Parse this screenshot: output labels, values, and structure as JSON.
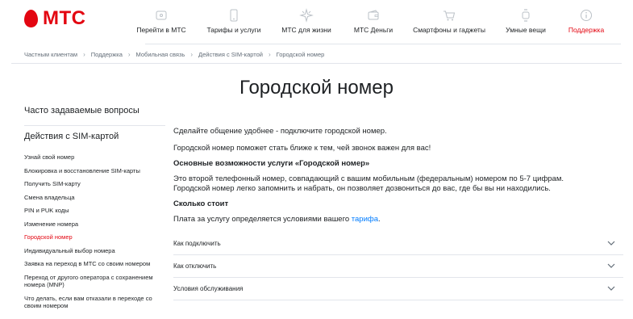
{
  "brand": {
    "name": "МТС",
    "color": "#e30611"
  },
  "nav": {
    "items": [
      {
        "icon": "mobile-icon",
        "label": "Перейти в МТС"
      },
      {
        "icon": "phone-icon",
        "label": "Тарифы и услуги"
      },
      {
        "icon": "sparkle-icon",
        "label": "МТС для жизни"
      },
      {
        "icon": "wallet-icon",
        "label": "МТС Деньги"
      },
      {
        "icon": "cart-icon",
        "label": "Смартфоны и гаджеты"
      },
      {
        "icon": "watch-icon",
        "label": "Умные вещи"
      },
      {
        "icon": "info-icon",
        "label": "Поддержка",
        "active": true
      }
    ]
  },
  "breadcrumb": [
    "Частным клиентам",
    "Поддержка",
    "Мобильная связь",
    "Действия с SIM-картой",
    "Городской номер"
  ],
  "page": {
    "title": "Городской номер"
  },
  "sidebar": {
    "faq": "Часто задаваемые вопросы",
    "heading": "Действия с SIM-картой",
    "items": [
      {
        "label": "Узнай свой номер"
      },
      {
        "label": "Блокировка и восстановление SIM-карты"
      },
      {
        "label": "Получить SIM-карту"
      },
      {
        "label": "Смена владельца"
      },
      {
        "label": "PIN и PUK коды"
      },
      {
        "label": "Изменение номера"
      },
      {
        "label": "Городской номер",
        "active": true
      },
      {
        "label": "Индивидуальный выбор номера"
      },
      {
        "label": "Заявка на переход в МТС со своим номером"
      },
      {
        "label": "Переход от другого оператора с сохранением номера (MNP)"
      },
      {
        "label": "Что делать, если вам отказали в переходе со своим номером"
      }
    ]
  },
  "content": {
    "intro": "Сделайте общение удобнее - подключите городской номер.",
    "intro2": "Городской номер поможет стать ближе к тем, чей звонок важен для вас!",
    "features_heading": "Основные возможности услуги «Городской номер»",
    "features_line1": "Это второй телефонный номер, совпадающий с вашим мобильным (федеральным) номером по 5-7 цифрам.",
    "features_line2": "Городской номер легко запомнить и набрать, он позволяет дозвониться до вас, где бы вы ни находились.",
    "price_heading": "Сколько стоит",
    "price_text": "Плата за услугу определяется условиями вашего ",
    "price_link": "тарифа",
    "price_end": ".",
    "link_color": "#007cff"
  },
  "accordion": [
    {
      "label": "Как подключить"
    },
    {
      "label": "Как отключить"
    },
    {
      "label": "Условия обслуживания"
    }
  ]
}
